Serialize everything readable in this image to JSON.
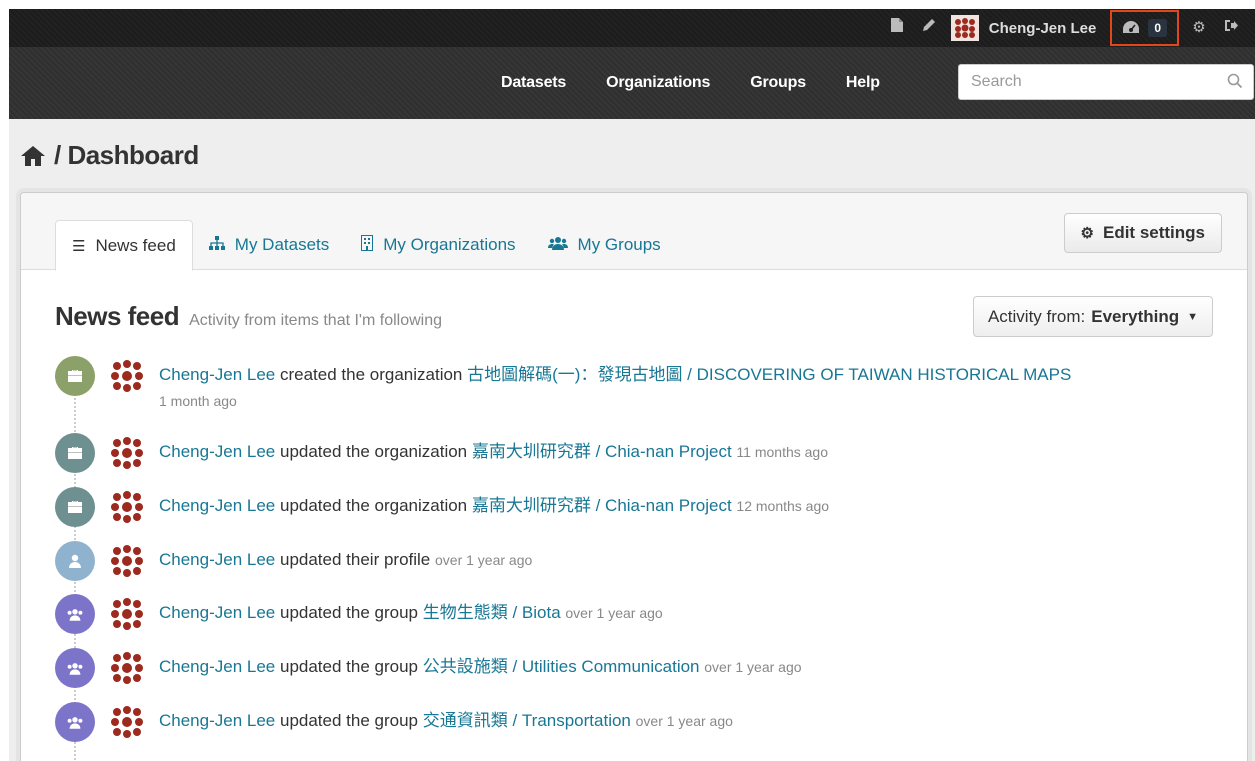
{
  "account": {
    "user_name": "Cheng-Jen Lee",
    "dashboard_count": "0",
    "accent": "#e2471c"
  },
  "nav": {
    "items": [
      "Datasets",
      "Organizations",
      "Groups",
      "Help"
    ],
    "search_placeholder": "Search"
  },
  "breadcrumb": {
    "title": "/ Dashboard"
  },
  "tabs": [
    {
      "label": "News feed",
      "icon": "list-icon",
      "active": true
    },
    {
      "label": "My Datasets",
      "icon": "sitemap-icon",
      "active": false
    },
    {
      "label": "My Organizations",
      "icon": "building-icon",
      "active": false
    },
    {
      "label": "My Groups",
      "icon": "group-icon",
      "active": false
    }
  ],
  "edit_settings_label": "Edit settings",
  "feed": {
    "title": "News feed",
    "subtitle": "Activity from items that I'm following",
    "activity_prefix": "Activity from:",
    "activity_value": "Everything"
  },
  "activities": [
    {
      "actor": "Cheng-Jen Lee",
      "action": " created the organization ",
      "object": "古地圖解碼(一)：發現古地圖 / DISCOVERING OF TAIWAN HISTORICAL MAPS",
      "time": "1 month ago",
      "icon": "briefcase-icon",
      "color": "#8ca169"
    },
    {
      "actor": "Cheng-Jen Lee",
      "action": " updated the organization ",
      "object": "嘉南大圳研究群 / Chia-nan Project",
      "time": "11 months ago",
      "icon": "briefcase-icon",
      "color": "#6f9090"
    },
    {
      "actor": "Cheng-Jen Lee",
      "action": " updated the organization ",
      "object": "嘉南大圳研究群 / Chia-nan Project",
      "time": "12 months ago",
      "icon": "briefcase-icon",
      "color": "#6f9090"
    },
    {
      "actor": "Cheng-Jen Lee",
      "action": " updated their profile",
      "object": "",
      "time": "over 1 year ago",
      "icon": "user-icon",
      "color": "#8fb3cf"
    },
    {
      "actor": "Cheng-Jen Lee",
      "action": " updated the group ",
      "object": "生物生態類 / Biota",
      "time": "over 1 year ago",
      "icon": "group-icon",
      "color": "#7c74c8"
    },
    {
      "actor": "Cheng-Jen Lee",
      "action": " updated the group ",
      "object": "公共設施類 / Utilities Communication",
      "time": "over 1 year ago",
      "icon": "group-icon",
      "color": "#7c74c8"
    },
    {
      "actor": "Cheng-Jen Lee",
      "action": " updated the group ",
      "object": "交通資訊類 / Transportation",
      "time": "over 1 year ago",
      "icon": "group-icon",
      "color": "#7c74c8"
    }
  ]
}
